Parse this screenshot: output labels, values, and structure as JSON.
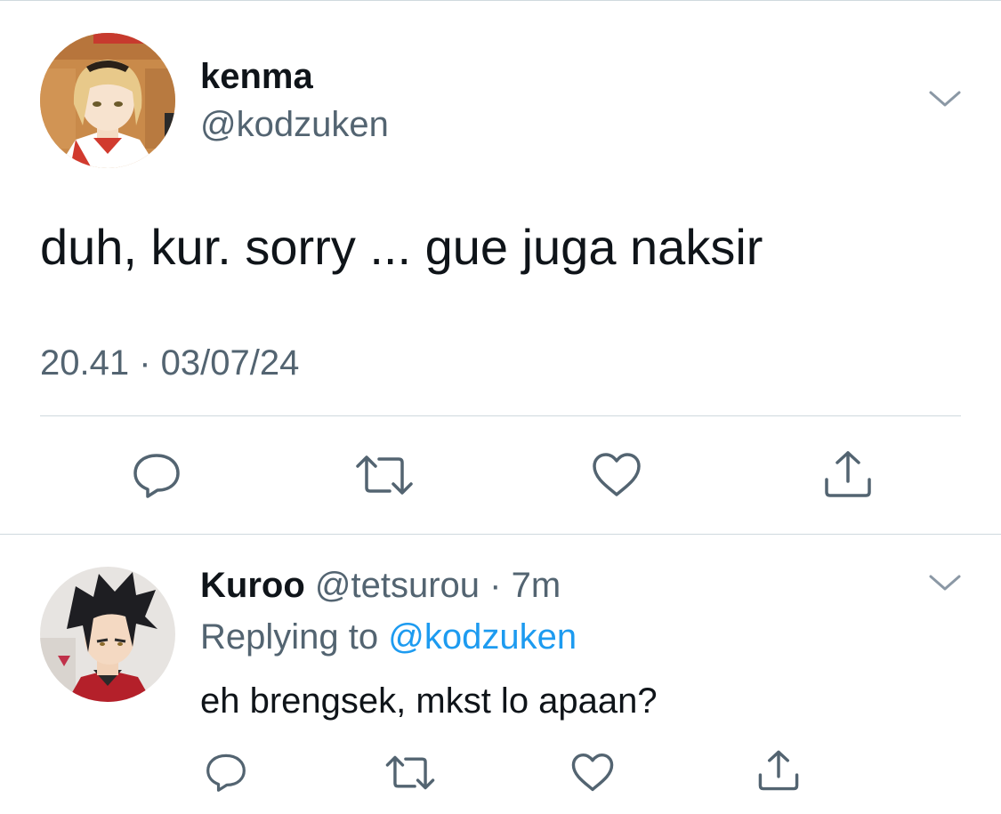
{
  "main_tweet": {
    "display_name": "kenma",
    "handle": "@kodzuken",
    "text": "duh, kur. sorry ... gue juga naksir",
    "timestamp": "20.41 · 03/07/24",
    "avatar": "anime-character-kenma-avatar",
    "actions": [
      "reply-icon",
      "retweet-icon",
      "like-icon",
      "share-icon"
    ]
  },
  "reply_tweet": {
    "display_name": "Kuroo",
    "handle": "@tetsurou",
    "separator": " · ",
    "time": "7m",
    "replying_prefix": "Replying to ",
    "replying_to": "@kodzuken",
    "text": "eh brengsek, mkst lo apaan?",
    "avatar": "anime-character-kuroo-avatar",
    "actions": [
      "reply-icon",
      "retweet-icon",
      "like-icon",
      "share-icon"
    ]
  },
  "colors": {
    "text_primary": "#0f1419",
    "text_secondary": "#536471",
    "mention": "#1d9bf0",
    "divider": "#cfd9de",
    "icon": "#536471"
  }
}
